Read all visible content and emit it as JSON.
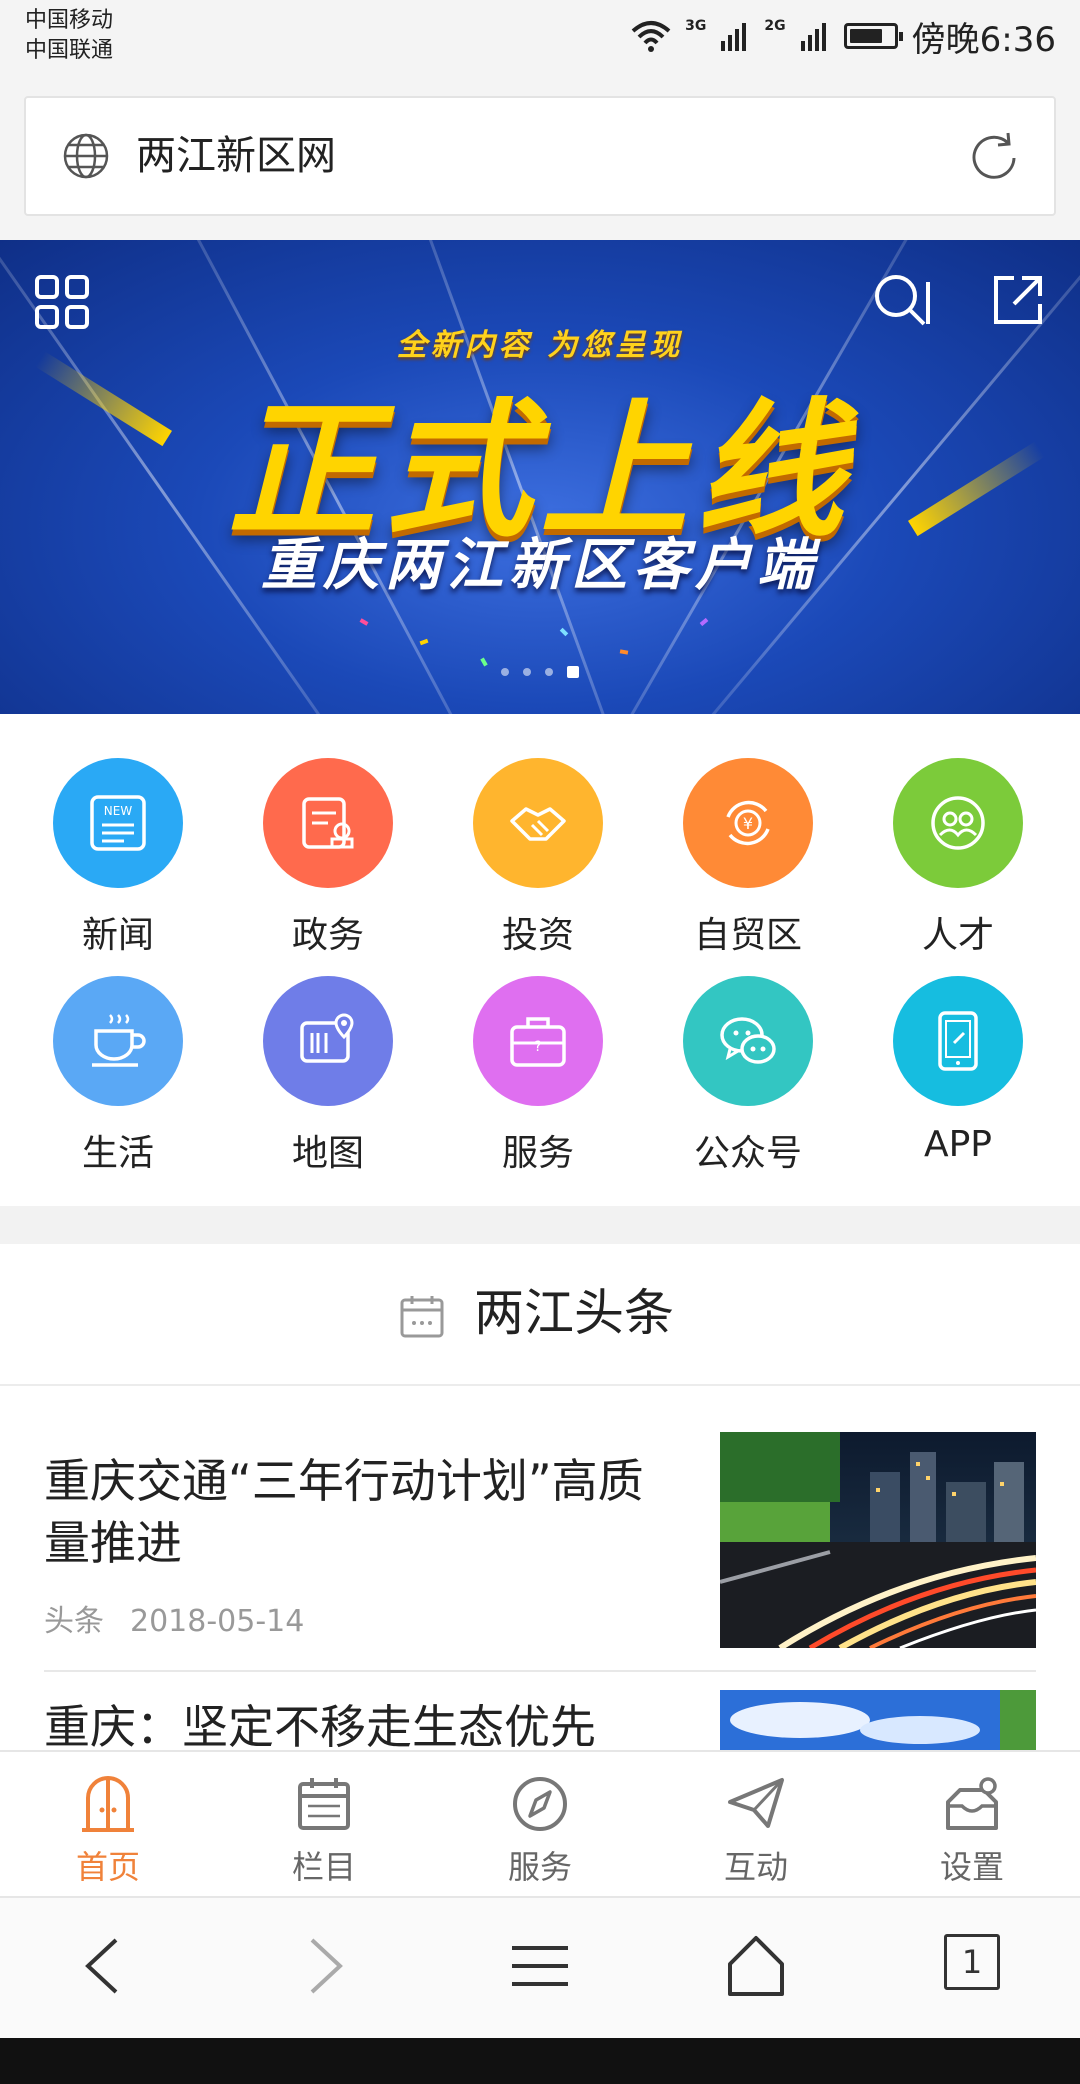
{
  "status_bar": {
    "carrier_1": "中国移动",
    "carrier_2": "中国联通",
    "network_1": "3G",
    "network_2": "2G",
    "battery_level_fraction": 0.75,
    "time": "傍晚6:36"
  },
  "address_bar": {
    "site_title": "两江新区网",
    "icons": [
      "globe-icon",
      "refresh-icon"
    ]
  },
  "banner": {
    "tagline": "全新内容 为您呈现",
    "headline": "正式上线",
    "subtitle": "重庆两江新区客户端",
    "icons": [
      "grid-icon",
      "search-icon",
      "share-icon"
    ],
    "slide_count": 4,
    "active_slide": 4,
    "background_color": "#1b49b8",
    "headline_color": "#ffd400"
  },
  "quick_links": [
    {
      "label": "新闻",
      "icon": "news-icon",
      "color": "#2aa9f5"
    },
    {
      "label": "政务",
      "icon": "government-icon",
      "color": "#ff6a4d"
    },
    {
      "label": "投资",
      "icon": "handshake-icon",
      "color": "#ffb52e"
    },
    {
      "label": "自贸区",
      "icon": "yuan-exchange-icon",
      "color": "#ff8a36"
    },
    {
      "label": "人才",
      "icon": "people-icon",
      "color": "#7ccb3a"
    },
    {
      "label": "生活",
      "icon": "coffee-cup-icon",
      "color": "#5aa8f5"
    },
    {
      "label": "地图",
      "icon": "map-icon",
      "color": "#6f7de8"
    },
    {
      "label": "服务",
      "icon": "briefcase-icon",
      "color": "#df6ff0"
    },
    {
      "label": "公众号",
      "icon": "wechat-icon",
      "color": "#33c6c2"
    },
    {
      "label": "APP",
      "icon": "tablet-icon",
      "color": "#16bde0"
    }
  ],
  "headlines_section": {
    "title": "两江头条",
    "icon": "calendar-icon"
  },
  "news": [
    {
      "title": "重庆交通“三年行动计划”高质量推进",
      "category": "头条",
      "date": "2018-05-14"
    },
    {
      "title": "重庆：坚定不移走生态优先"
    }
  ],
  "tab_bar": [
    {
      "label": "首页",
      "icon": "home-door-icon",
      "active": true
    },
    {
      "label": "栏目",
      "icon": "calendar-grid-icon",
      "active": false
    },
    {
      "label": "服务",
      "icon": "compass-icon",
      "active": false
    },
    {
      "label": "互动",
      "icon": "paper-plane-icon",
      "active": false
    },
    {
      "label": "设置",
      "icon": "settings-box-icon",
      "active": false
    }
  ],
  "tab_active_color": "#f0823a",
  "browser_nav": {
    "tabs_count": "1",
    "icons": [
      "back-icon",
      "forward-icon",
      "menu-icon",
      "home-icon",
      "tabs-icon"
    ]
  }
}
